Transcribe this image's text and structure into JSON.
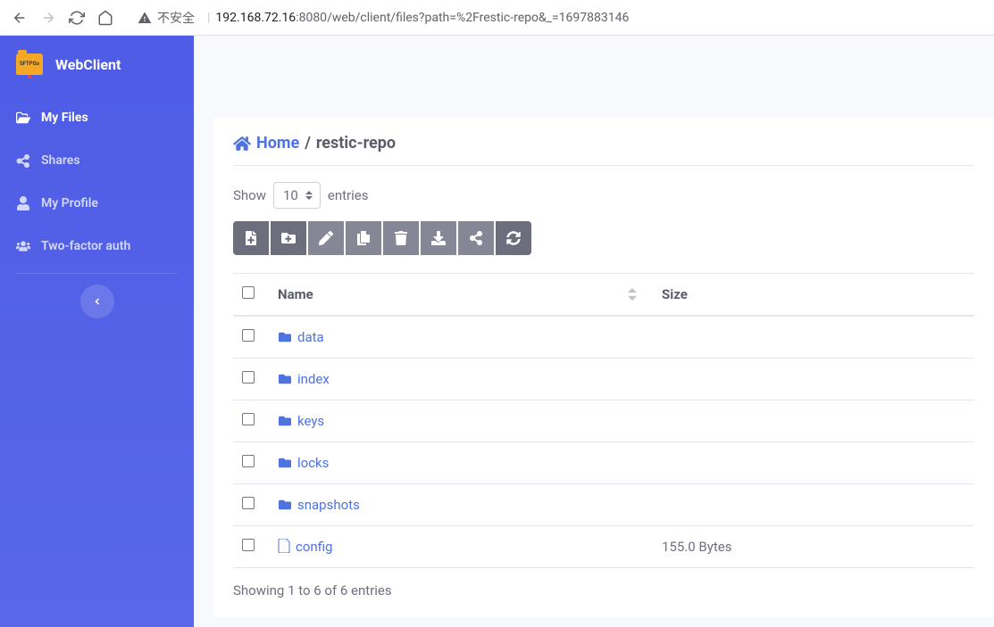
{
  "browser": {
    "warning_label": "不安全",
    "url_host": "192.168.72.16",
    "url_port": ":8080",
    "url_path": "/web/client/files?path=%2Frestic-repo&_=1697883146"
  },
  "brand": {
    "logo_text": "SFTPGo",
    "name": "WebClient"
  },
  "nav": {
    "my_files": "My Files",
    "shares": "Shares",
    "my_profile": "My Profile",
    "two_factor": "Two-factor auth"
  },
  "breadcrumb": {
    "home": "Home",
    "current": "restic-repo"
  },
  "table": {
    "show_label": "Show",
    "entries_label": "entries",
    "page_size": "10",
    "col_name": "Name",
    "col_size": "Size",
    "rows": [
      {
        "type": "folder",
        "name": "data",
        "size": ""
      },
      {
        "type": "folder",
        "name": "index",
        "size": ""
      },
      {
        "type": "folder",
        "name": "keys",
        "size": ""
      },
      {
        "type": "folder",
        "name": "locks",
        "size": ""
      },
      {
        "type": "folder",
        "name": "snapshots",
        "size": ""
      },
      {
        "type": "file",
        "name": "config",
        "size": "155.0 Bytes"
      }
    ],
    "footer": "Showing 1 to 6 of 6 entries"
  },
  "icons": {
    "toolbar": [
      "file-add",
      "folder-add",
      "edit",
      "copy",
      "delete",
      "download",
      "share",
      "refresh"
    ]
  }
}
